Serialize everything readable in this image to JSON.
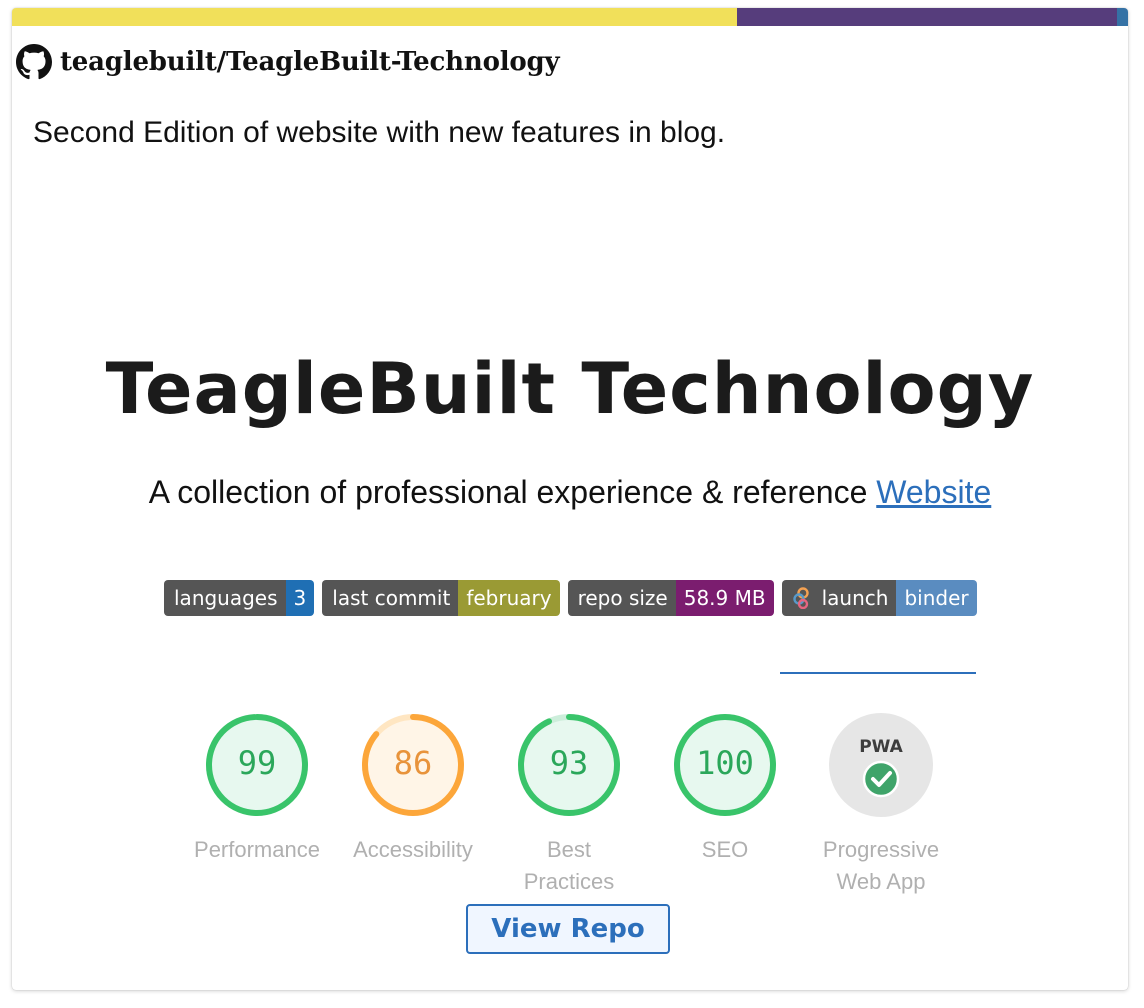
{
  "colors": {
    "lang_bar": [
      "#f1e05a",
      "#563d7c",
      "#3572a5"
    ],
    "link": "#2c6fbb"
  },
  "repo": {
    "full_name": "teaglebuilt/TeagleBuilt-Technology",
    "description": "Second Edition of website with new features in blog.",
    "icon": "github-icon"
  },
  "readme": {
    "title": "TeagleBuilt Technology",
    "subtitle_text": "A collection of professional experience & reference ",
    "subtitle_link": "Website"
  },
  "badges": [
    {
      "left": "languages",
      "right": "3",
      "right_color": "#1f6fb4"
    },
    {
      "left": "last commit",
      "right": "february",
      "right_color": "#9a9a34"
    },
    {
      "left": "repo size",
      "right": "58.9 MB",
      "right_color": "#7b1d6f"
    },
    {
      "left": "launch",
      "right": "binder",
      "right_color": "#5a8cc0",
      "icon": "binder-icon"
    }
  ],
  "lighthouse": [
    {
      "label": "Performance",
      "score": 99,
      "color": "#0cce6b"
    },
    {
      "label": "Accessibility",
      "score": 86,
      "color": "#ffa400"
    },
    {
      "label": "Best Practices",
      "score": 93,
      "color": "#0cce6b"
    },
    {
      "label": "SEO",
      "score": 100,
      "color": "#0cce6b"
    },
    {
      "label": "Progressive Web App",
      "score": "PWA",
      "icon": "check-icon"
    }
  ],
  "actions": {
    "view_repo": "View Repo"
  }
}
